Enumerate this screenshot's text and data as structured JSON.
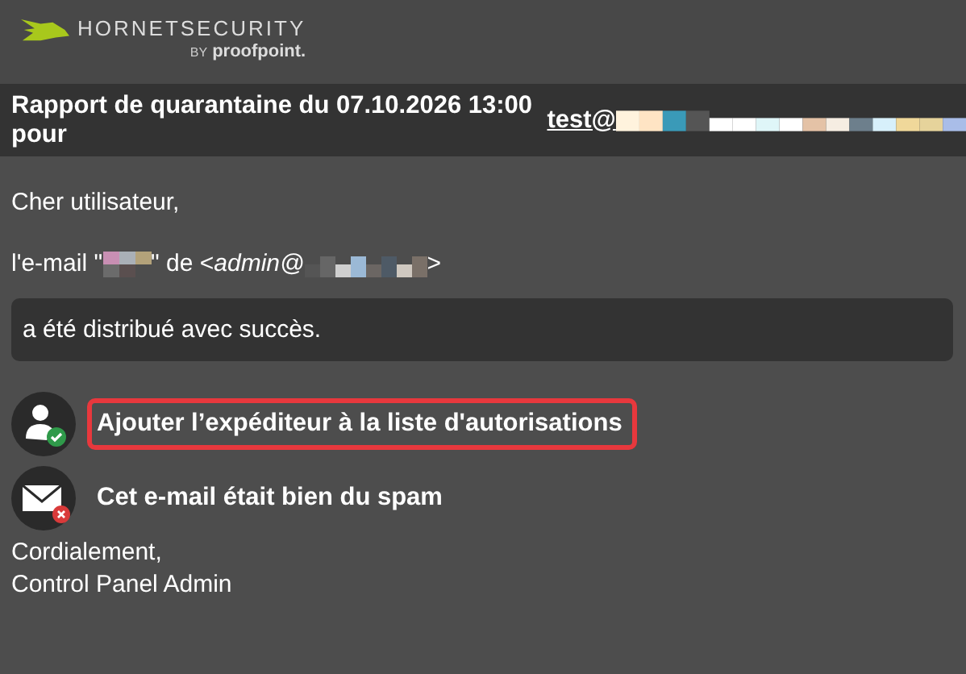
{
  "logo": {
    "brand": "HORNETSECURITY",
    "by": "BY",
    "partner": "proofpoint."
  },
  "title_bar": {
    "text": "Rapport de quarantaine du 07.10.2026 13:00 pour",
    "link": "test@"
  },
  "greeting": "Cher utilisateur,",
  "mail_line": {
    "prefix": "l'e-mail \"",
    "middle": "\" de <",
    "sender": "admin@",
    "suffix": ">"
  },
  "status": "a été distribué avec succès.",
  "actions": [
    {
      "kind": "allow",
      "label": "Ajouter l’expéditeur à la liste d'autorisations",
      "highlighted": true
    },
    {
      "kind": "spam",
      "label": "Cet e-mail était bien du spam",
      "highlighted": false
    }
  ],
  "signature": [
    "Cordialement,",
    "Control Panel Admin"
  ]
}
